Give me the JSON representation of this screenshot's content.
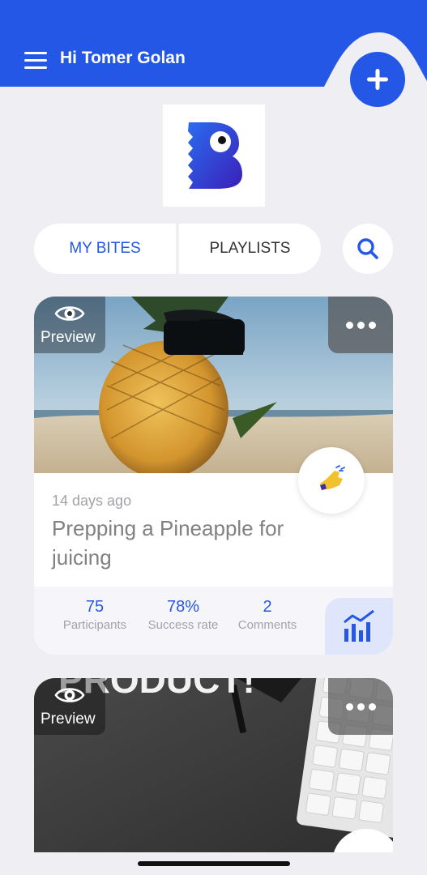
{
  "header": {
    "greeting": "Hi Tomer Golan",
    "accent": "#2457e6"
  },
  "icons": {
    "menu": "hamburger-menu-icon",
    "add": "plus-icon",
    "search": "search-icon",
    "preview": "eye-icon",
    "more": "more-dots-icon",
    "bite": "hand-pointer-icon",
    "stats": "bar-chart-icon"
  },
  "tabs": [
    {
      "label": "MY BITES",
      "active": true
    },
    {
      "label": "PLAYLISTS",
      "active": false
    }
  ],
  "cards": [
    {
      "preview_label": "Preview",
      "date": "14 days ago",
      "title": "Prepping a Pineapple for juicing",
      "stats": [
        {
          "value": "75",
          "label": "Participants"
        },
        {
          "value": "78%",
          "label": "Success rate"
        },
        {
          "value": "2",
          "label": "Comments"
        }
      ]
    },
    {
      "preview_label": "Preview",
      "thumb_text": "PRODUCT!"
    }
  ]
}
